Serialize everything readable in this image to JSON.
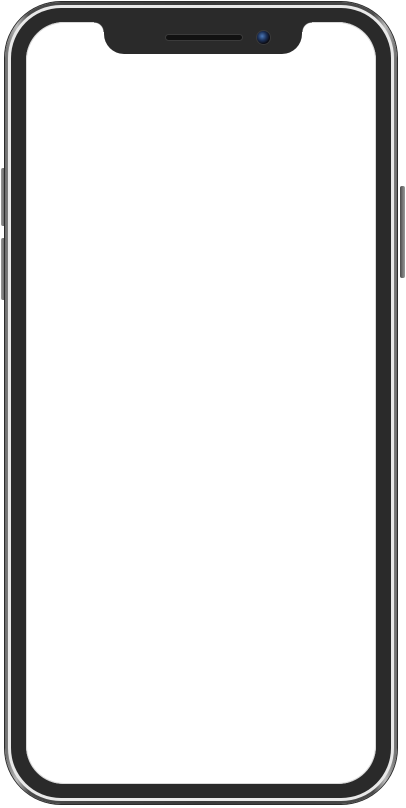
{
  "device": {
    "type": "phone",
    "notch": true,
    "screen": {
      "content": "blank",
      "background": "#ffffff"
    },
    "colors": {
      "frame": "#3a3a3a",
      "bezel": "#2a2a2a",
      "band": "#e9e9e9",
      "camera": "#1b2f55"
    },
    "buttons": [
      "mute-switch",
      "volume-button",
      "power-button"
    ]
  }
}
